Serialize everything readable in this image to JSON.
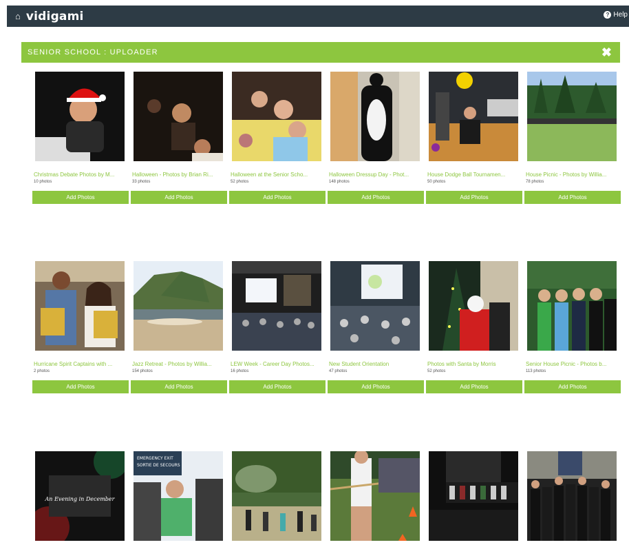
{
  "header": {
    "home_icon": "home-icon",
    "brand": "vidigami",
    "help_icon": "question-circle-icon",
    "help_label": "Help"
  },
  "banner": {
    "title": "SENIOR SCHOOL : UPLOADER",
    "close_icon": "close-icon"
  },
  "colors": {
    "topbar": "#2d3b45",
    "accent": "#8dc63f"
  },
  "albums": [
    {
      "title": "Christmas Debate Photos by M...",
      "count": "10 photos",
      "button": "Add Photos"
    },
    {
      "title": "Halloween - Photos by Brian Ri...",
      "count": "33 photos",
      "button": "Add Photos"
    },
    {
      "title": "Halloween at the Senior Scho...",
      "count": "52 photos",
      "button": "Add Photos"
    },
    {
      "title": "Halloween Dressup Day - Phot...",
      "count": "148 photos",
      "button": "Add Photos"
    },
    {
      "title": "House Dodge Ball Tournamen...",
      "count": "50 photos",
      "button": "Add Photos"
    },
    {
      "title": "House Picnic - Photos by Willia...",
      "count": "78 photos",
      "button": "Add Photos"
    },
    {
      "title": "Hurricane Spirit Captains with ...",
      "count": "2 photos",
      "button": "Add Photos"
    },
    {
      "title": "Jazz Retreat - Photos by Willia...",
      "count": "154 photos",
      "button": "Add Photos"
    },
    {
      "title": "LEW Week - Career Day Photos...",
      "count": "16 photos",
      "button": "Add Photos"
    },
    {
      "title": "New Student Orientation",
      "count": "47 photos",
      "button": "Add Photos"
    },
    {
      "title": "Photos with Santa by Morris",
      "count": "52 photos",
      "button": "Add Photos"
    },
    {
      "title": "Senior House Picnic - Photos b...",
      "count": "113 photos",
      "button": "Add Photos"
    }
  ],
  "bottom_thumbs": [
    {
      "caption": "An Evening in December"
    },
    {
      "caption": "EMERGENCY EXIT SORTIE DE SECOURS"
    },
    {
      "caption": ""
    },
    {
      "caption": ""
    },
    {
      "caption": ""
    },
    {
      "caption": ""
    }
  ]
}
